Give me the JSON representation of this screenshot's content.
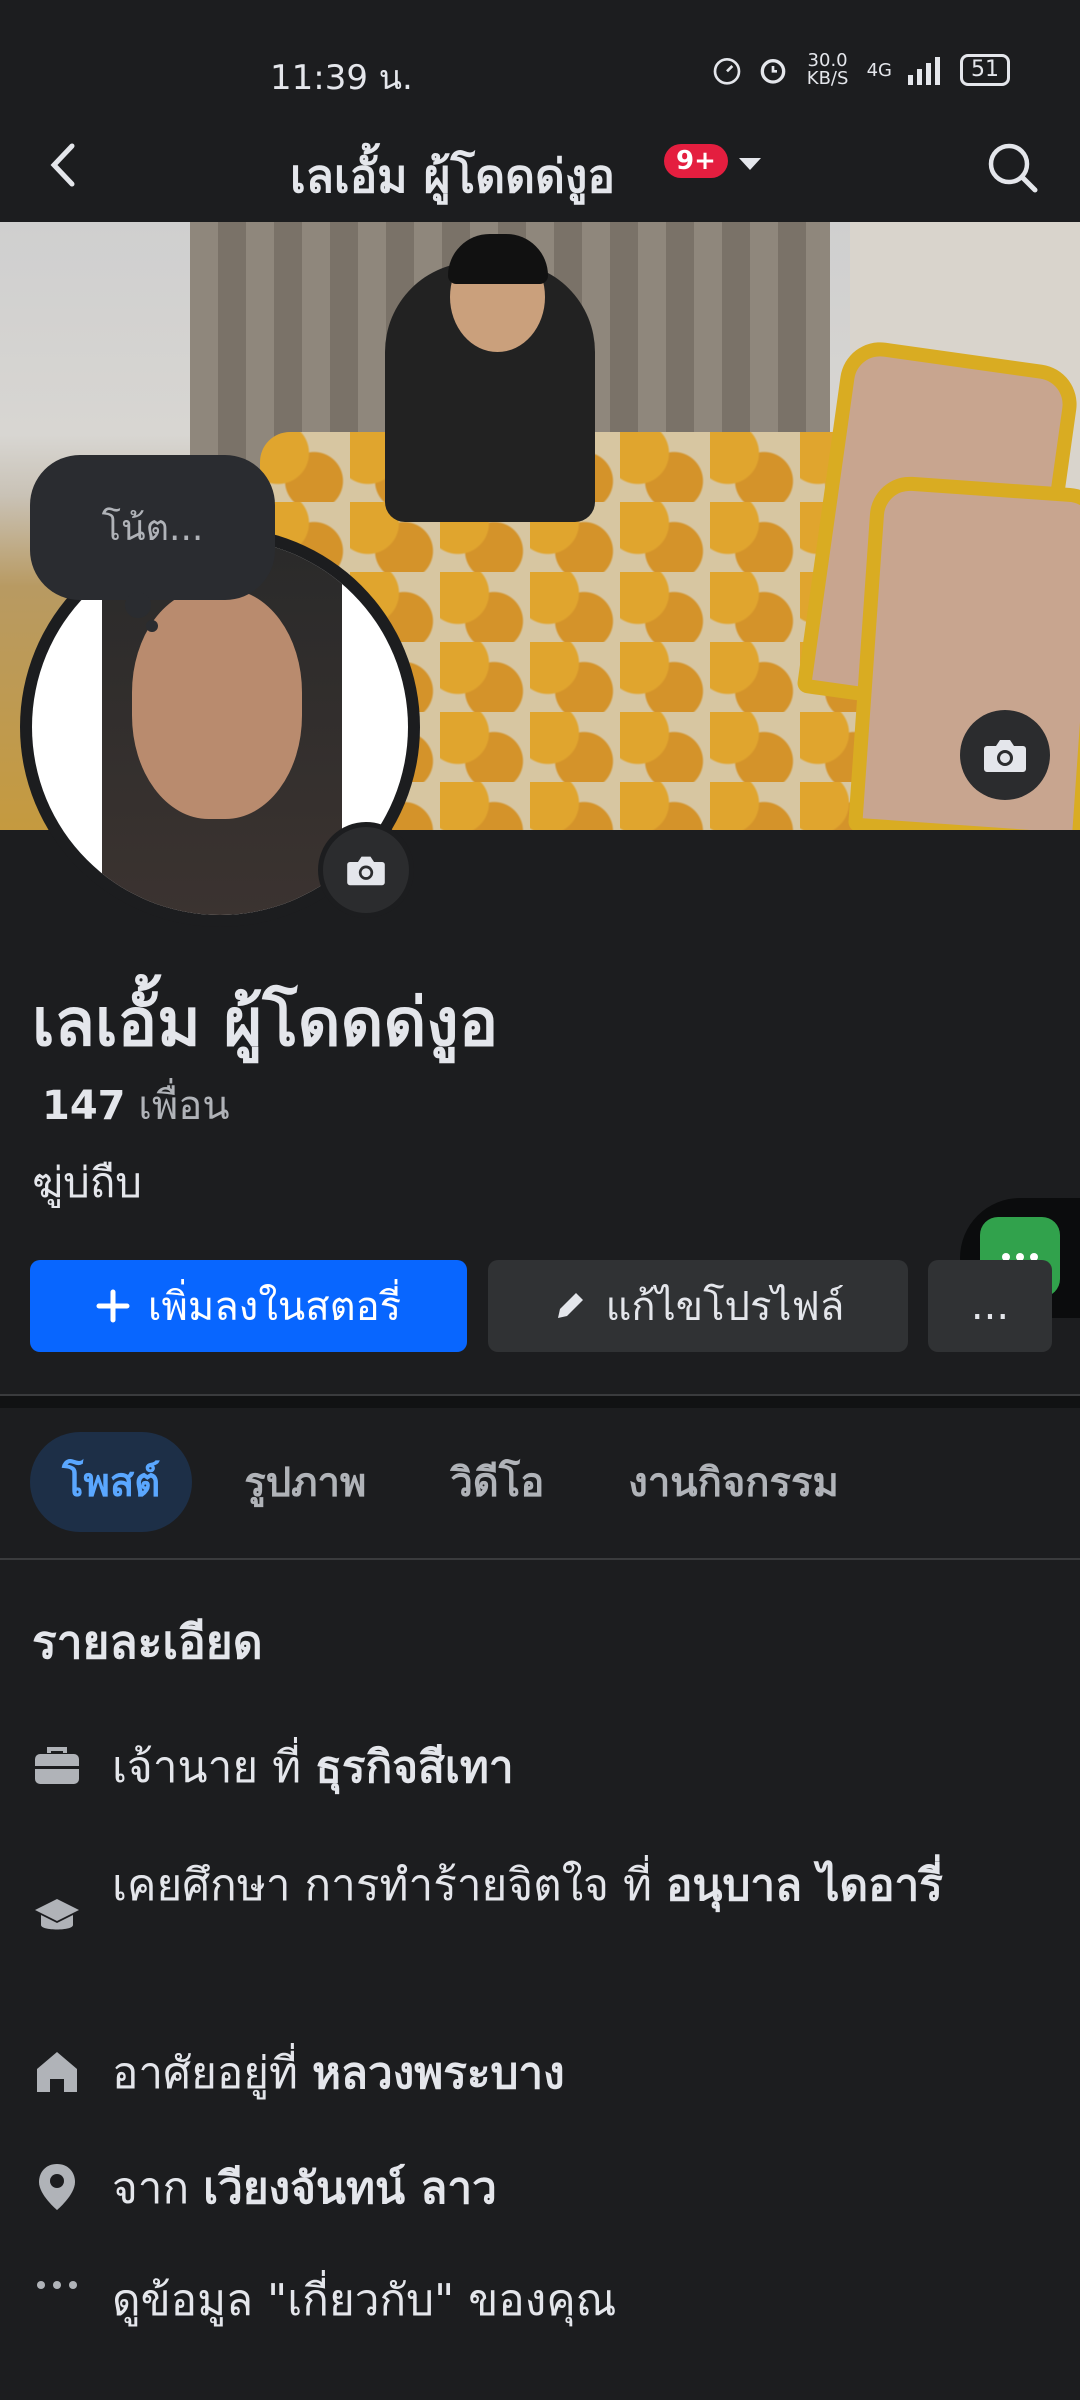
{
  "status_bar": {
    "time": "11:39 น.",
    "network_speed": "30.0 KB/S",
    "network_type": "4G",
    "battery": "51"
  },
  "header": {
    "title": "เลเอั้ม ผู้โดดด่งูอ",
    "badge": "9+"
  },
  "profile": {
    "note_placeholder": "โน้ต...",
    "name": "เลเอั้ม ผู้โดดด่งูอ",
    "friends_count": "147",
    "friends_label": "เพื่อน",
    "bio": "ฆู่บ่ถืบ"
  },
  "actions": {
    "add_story_label": "เพิ่มลงในสตอรี่",
    "edit_profile_label": "แก้ไขโปรไฟล์",
    "more_label": "..."
  },
  "tabs": [
    {
      "label": "โพสต์",
      "active": true
    },
    {
      "label": "รูปภาพ",
      "active": false
    },
    {
      "label": "วิดีโอ",
      "active": false
    },
    {
      "label": "งานกิจกรรม",
      "active": false
    }
  ],
  "details": {
    "title": "รายละเอียด",
    "work_prefix": "เจ้านาย ที่ ",
    "work_place": "ธุรกิจสีเทา",
    "education_prefix": "เคยศึกษา การทำร้ายจิตใจ ที่ ",
    "education_place": "อนุบาล ไดอารี่",
    "lives_prefix": "อาศัยอยู่ที่ ",
    "lives_place": "หลวงพระบาง",
    "from_prefix": "จาก ",
    "from_place": "เวียงจันทน์ ลาว",
    "about_link": "ดูข้อมูล \"เกี่ยวกับ\" ของคุณ"
  },
  "colors": {
    "background": "#1c1d1f",
    "primary_button": "#0866ff",
    "active_tab_text": "#5aa7ff",
    "badge": "#e41e3f",
    "chat_head": "#31a24c"
  }
}
